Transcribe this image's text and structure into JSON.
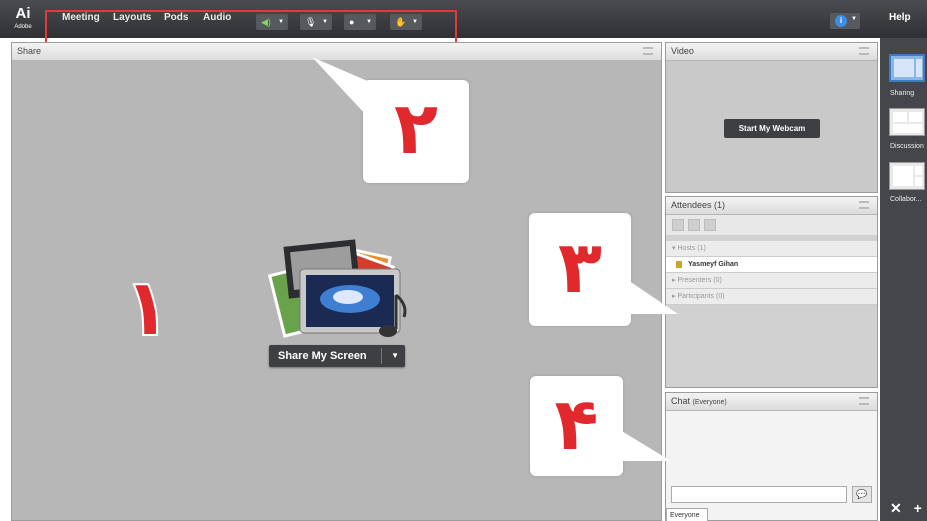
{
  "app": {
    "logo": {
      "glyph": "Ai",
      "sub": "Adobe"
    },
    "menu": [
      {
        "label": "Meeting"
      },
      {
        "label": "Layouts"
      },
      {
        "label": "Pods"
      },
      {
        "label": "Audio"
      }
    ],
    "toolbar_icons": [
      "speaker-icon",
      "microphone-icon",
      "webcam-icon",
      "raise-hand-icon"
    ],
    "help_label": "Help",
    "accent": "#e0282d"
  },
  "share_pod": {
    "title": "Share",
    "button_label": "Share My Screen"
  },
  "video_pod": {
    "title": "Video",
    "button_label": "Start My Webcam"
  },
  "attendees_pod": {
    "title": "Attendees",
    "count": "(1)",
    "groups": [
      {
        "label": "Hosts (1)"
      },
      {
        "label": "Yasmeyf Gihan"
      },
      {
        "label": "Presenters (0)"
      },
      {
        "label": "Participants (0)"
      }
    ]
  },
  "chat_pod": {
    "title": "Chat",
    "scope": "(Everyone)",
    "tab_label": "Everyone"
  },
  "layouts": [
    {
      "label": "Sharing"
    },
    {
      "label": "Discussion"
    },
    {
      "label": "Collabor..."
    }
  ],
  "callouts": [
    {
      "number": "١"
    },
    {
      "number": "٢"
    },
    {
      "number": "٣"
    },
    {
      "number": "۴"
    }
  ]
}
